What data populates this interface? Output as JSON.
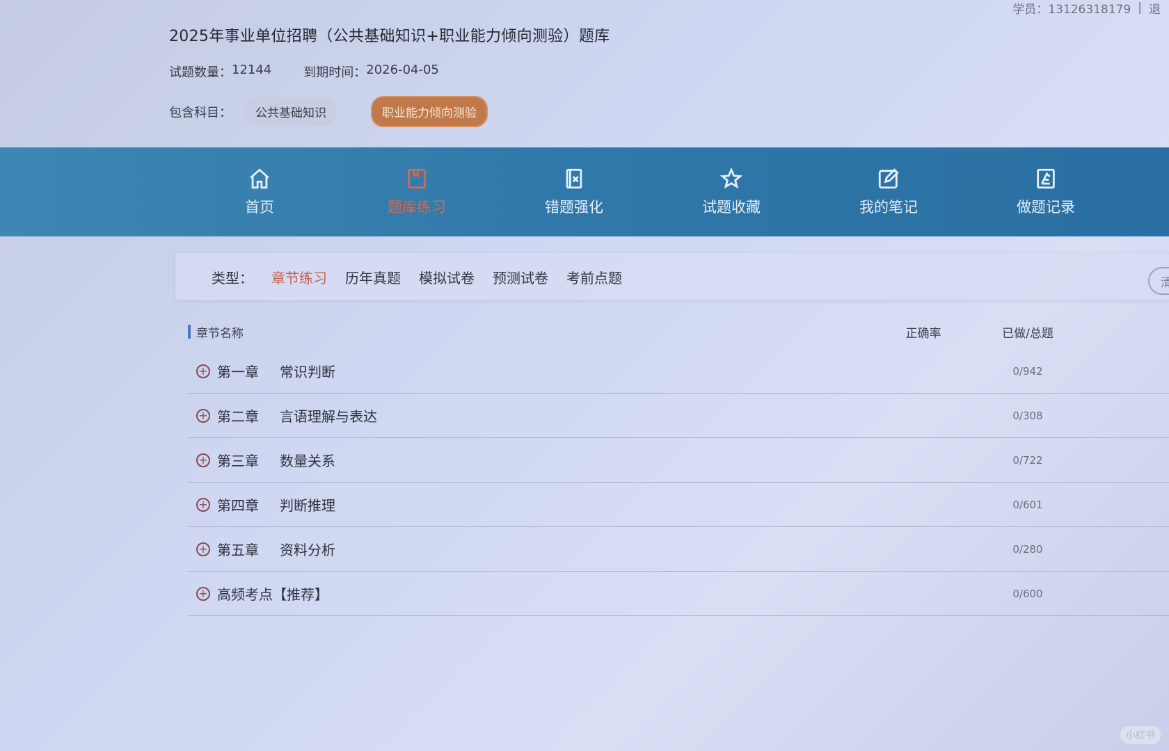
{
  "top_right": {
    "account": "学员：13126318179",
    "separator": "|",
    "logout": "退"
  },
  "header": {
    "title": "2025年事业单位招聘（公共基础知识+职业能力倾向测验）题库",
    "count_label": "试题数量：",
    "count_value": "12144",
    "expire_label": "到期时间：",
    "expire_value": "2026-04-05",
    "subjects_label": "包含科目：",
    "subjects": [
      "公共基础知识",
      "职业能力倾向测验"
    ],
    "active_subject": "职业能力倾向测验"
  },
  "nav": {
    "items": [
      {
        "label": "首页",
        "icon": "home-icon"
      },
      {
        "label": "题库练习",
        "icon": "book-icon"
      },
      {
        "label": "错题强化",
        "icon": "wrong-question-icon"
      },
      {
        "label": "试题收藏",
        "icon": "star-icon"
      },
      {
        "label": "我的笔记",
        "icon": "edit-note-icon"
      },
      {
        "label": "做题记录",
        "icon": "record-icon"
      }
    ],
    "active": "题库练习"
  },
  "filter": {
    "type_label": "类型：",
    "tabs": [
      "章节练习",
      "历年真题",
      "模拟试卷",
      "预测试卷",
      "考前点题"
    ],
    "active": "章节练习",
    "clear_label": "清"
  },
  "table": {
    "headers": {
      "name": "章节名称",
      "accuracy": "正确率",
      "done_total": "已做/总题"
    },
    "rows": [
      {
        "chapter": "第一章",
        "title": "常识判断",
        "accuracy": "",
        "done_total": "0/942"
      },
      {
        "chapter": "第二章",
        "title": "言语理解与表达",
        "accuracy": "",
        "done_total": "0/308"
      },
      {
        "chapter": "第三章",
        "title": "数量关系",
        "accuracy": "",
        "done_total": "0/722"
      },
      {
        "chapter": "第四章",
        "title": "判断推理",
        "accuracy": "",
        "done_total": "0/601"
      },
      {
        "chapter": "第五章",
        "title": "资料分析",
        "accuracy": "",
        "done_total": "0/280"
      },
      {
        "chapter": "",
        "title": "高频考点【推荐】",
        "accuracy": "",
        "done_total": "0/600"
      }
    ]
  },
  "watermark": "小红书",
  "colors": {
    "nav_bg": "#3079aa",
    "accent": "#c4614f",
    "chip_active": "#c07a4a"
  }
}
